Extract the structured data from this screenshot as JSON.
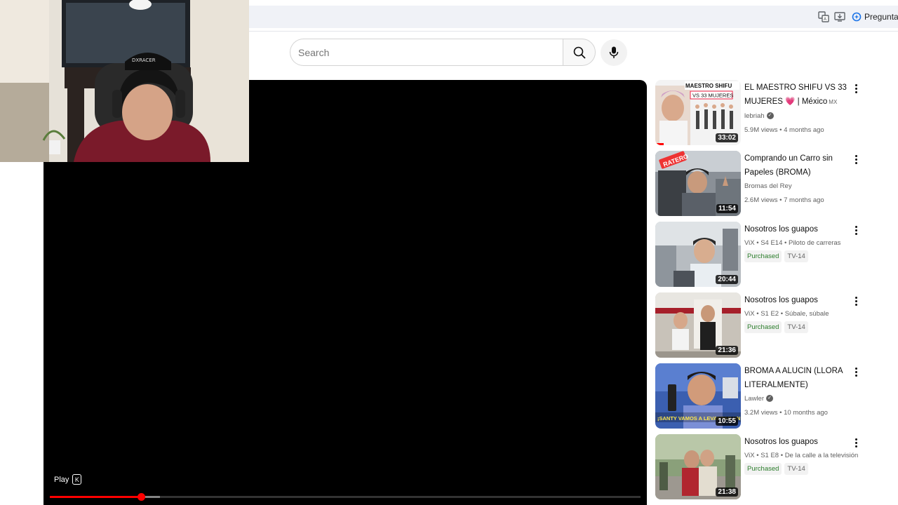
{
  "browser": {
    "ask_label": "Preguntar a",
    "icons": [
      "translate-icon",
      "install-app-icon",
      "gemini-ask-icon"
    ]
  },
  "search": {
    "placeholder": "Search",
    "search_icon": "search-icon",
    "mic_icon": "microphone-icon"
  },
  "player": {
    "play_label": "Play",
    "play_shortcut": "K",
    "progress_played": 0.154,
    "progress_buffered": 0.186,
    "colors": {
      "played": "#ff0000",
      "background": "#000000"
    }
  },
  "sidebar": {
    "items": [
      {
        "title": "EL MAESTRO SHIFU VS 33 MUJERES 💗 | México",
        "country": "MX",
        "channel": "lebriah",
        "verified": true,
        "stats": "5.9M views • 4 months ago",
        "duration": "33:02",
        "thumb_text_1": "MAESTRO SHIFU",
        "thumb_text_2": "VS 33 MUJERES",
        "watched": 0.1
      },
      {
        "title": "Comprando un Carro sin Papeles (BROMA)",
        "channel": "Bromas del Rey",
        "verified": false,
        "stats": "2.6M views • 7 months ago",
        "duration": "11:54",
        "thumb_text_1": "RATERO"
      },
      {
        "title": "Nosotros los guapos",
        "channel": "ViX • S4 E14 • Piloto de carreras",
        "purchased": "Purchased",
        "rating": "TV-14",
        "duration": "20:44"
      },
      {
        "title": "Nosotros los guapos",
        "channel": "ViX • S1 E2 • Súbale, súbale",
        "purchased": "Purchased",
        "rating": "TV-14",
        "duration": "21:36"
      },
      {
        "title": "BROMA A ALUCIN (LLORA LITERALMENTE)",
        "channel": "Lawler",
        "verified": true,
        "stats": "3.2M views • 10 months ago",
        "duration": "10:55",
        "thumb_text_1": "¡SANTY VAMOS A LEVANTAR UN"
      },
      {
        "title": "Nosotros los guapos",
        "channel": "ViX • S1 E8 • De la calle a la televisión",
        "purchased": "Purchased",
        "rating": "TV-14",
        "duration": "21:38"
      }
    ]
  }
}
